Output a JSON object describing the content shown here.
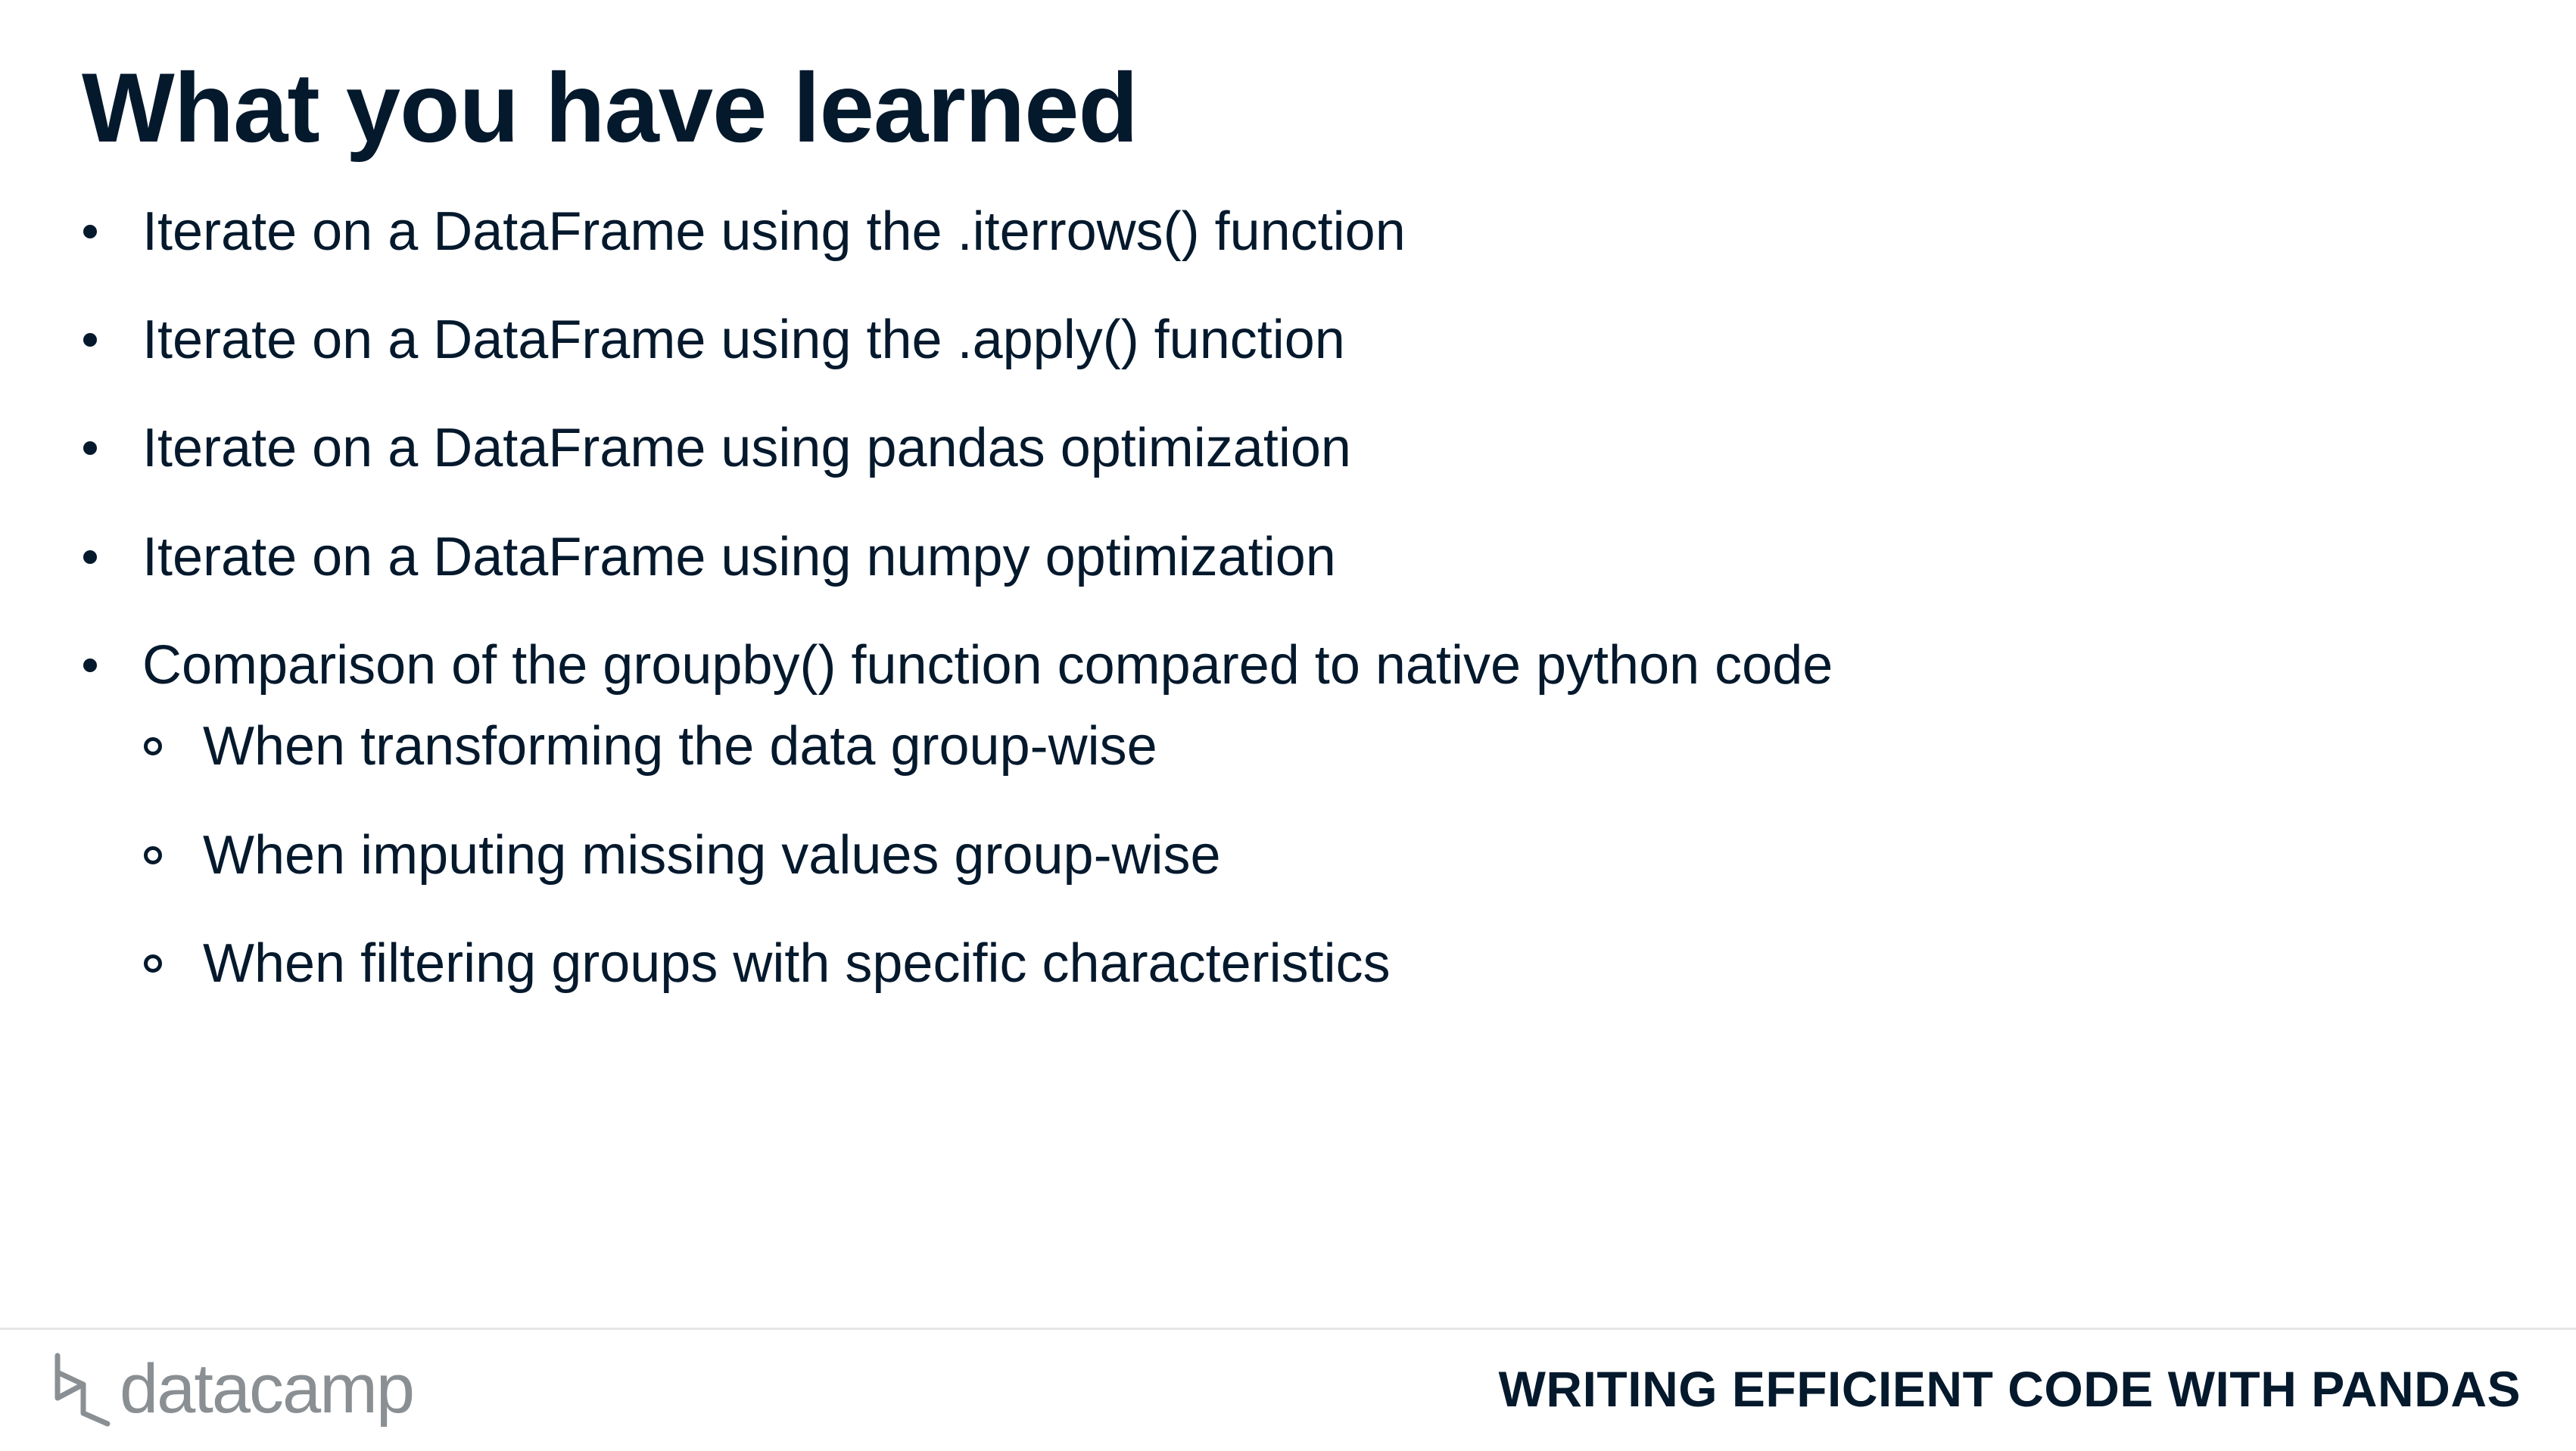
{
  "slide": {
    "title": "What you have learned",
    "bullets": [
      "Iterate on a DataFrame using the .iterrows() function",
      "Iterate on a DataFrame using the .apply() function",
      "Iterate on a DataFrame using pandas optimization",
      "Iterate on a DataFrame using numpy optimization",
      "Comparison of the groupby() function compared to native python code"
    ],
    "sub_bullets": [
      "When transforming the data group-wise",
      "When imputing missing values group-wise",
      "When filtering groups with specific characteristics"
    ]
  },
  "footer": {
    "logo_text": "datacamp",
    "course_name": "WRITING EFFICIENT CODE WITH PANDAS"
  },
  "colors": {
    "text": "#05192d",
    "logo_gray": "#8a8f93",
    "divider": "#e5e5e5",
    "background": "#ffffff"
  }
}
